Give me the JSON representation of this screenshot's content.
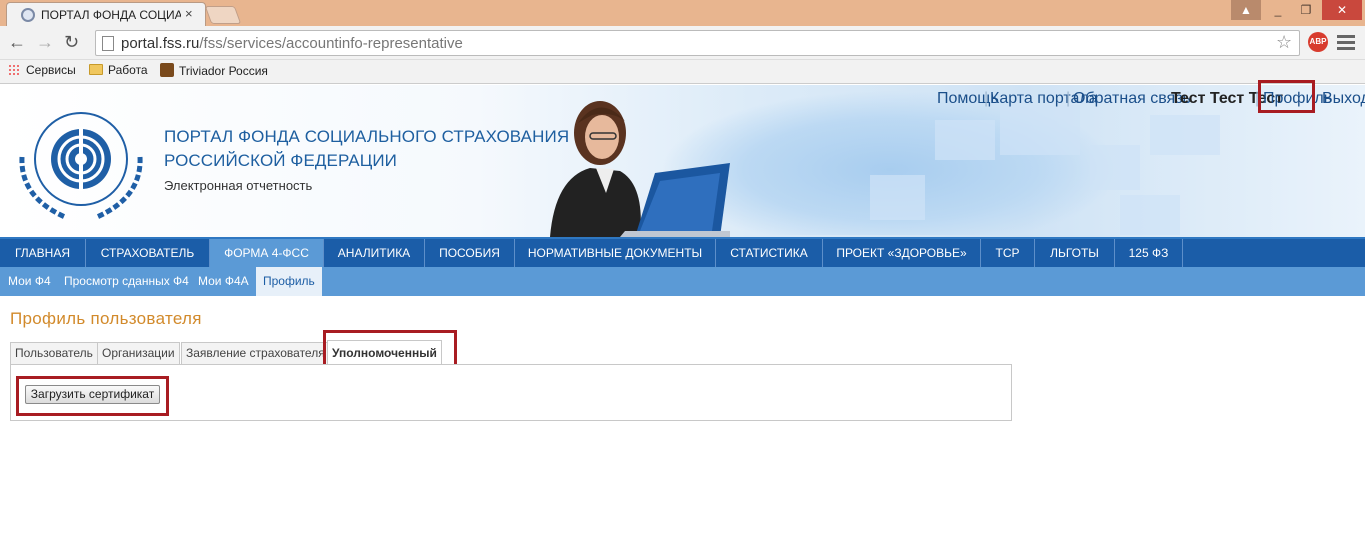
{
  "browser": {
    "tab_title": "ПОРТАЛ ФОНДА СОЦИА",
    "tab_close": "×",
    "url_host": "portal.fss.ru",
    "url_path": "/fss/services/accountinfo-representative",
    "window_user": "▲",
    "window_min": "_",
    "window_max": "❐",
    "window_close": "✕",
    "back": "←",
    "forward": "→",
    "reload": "↻",
    "star": "☆",
    "abp": "ABP",
    "bookmarks": [
      "Сервисы",
      "Работа",
      "Triviador Россия"
    ]
  },
  "site": {
    "title_line1": "ПОРТАЛ ФОНДА СОЦИАЛЬНОГО СТРАХОВАНИЯ",
    "title_line2": "РОССИЙСКОЙ ФЕДЕРАЦИИ",
    "subtitle": "Электронная отчетность",
    "logo_text": "ФОНД СОЦИАЛЬНОГО СТРАХОВАНИЯ РОССИЙСКОЙ ФЕДЕРАЦИИ",
    "links": {
      "help": "Помощь",
      "sitemap": "Карта портала",
      "feedback": "Обратная связь",
      "user": "Тест Тест Тест",
      "profile": "Профиль",
      "logout": "Выход",
      "separator": "|"
    }
  },
  "main_nav": [
    "ГЛАВНАЯ",
    "СТРАХОВАТЕЛЬ",
    "ФОРМА 4-ФСС",
    "АНАЛИТИКА",
    "ПОСОБИЯ",
    "НОРМАТИВНЫЕ ДОКУМЕНТЫ",
    "СТАТИСТИКА",
    "ПРОЕКТ «ЗДОРОВЬЕ»",
    "ТСР",
    "ЛЬГОТЫ",
    "125 ФЗ"
  ],
  "sub_nav": [
    "Мои Ф4",
    "Просмотр сданных Ф4",
    "Мои Ф4А",
    "Профиль"
  ],
  "content": {
    "page_title": "Профиль пользователя",
    "tabs": [
      "Пользователь",
      "Организации",
      "Заявление страхователя",
      "Уполномоченный"
    ],
    "upload_button": "Загрузить сертификат"
  },
  "colors": {
    "nav_bg": "#1b5da8",
    "nav_active": "#5b9ad6",
    "title_orange": "#d28a2b",
    "highlight_red": "#a81c22"
  }
}
